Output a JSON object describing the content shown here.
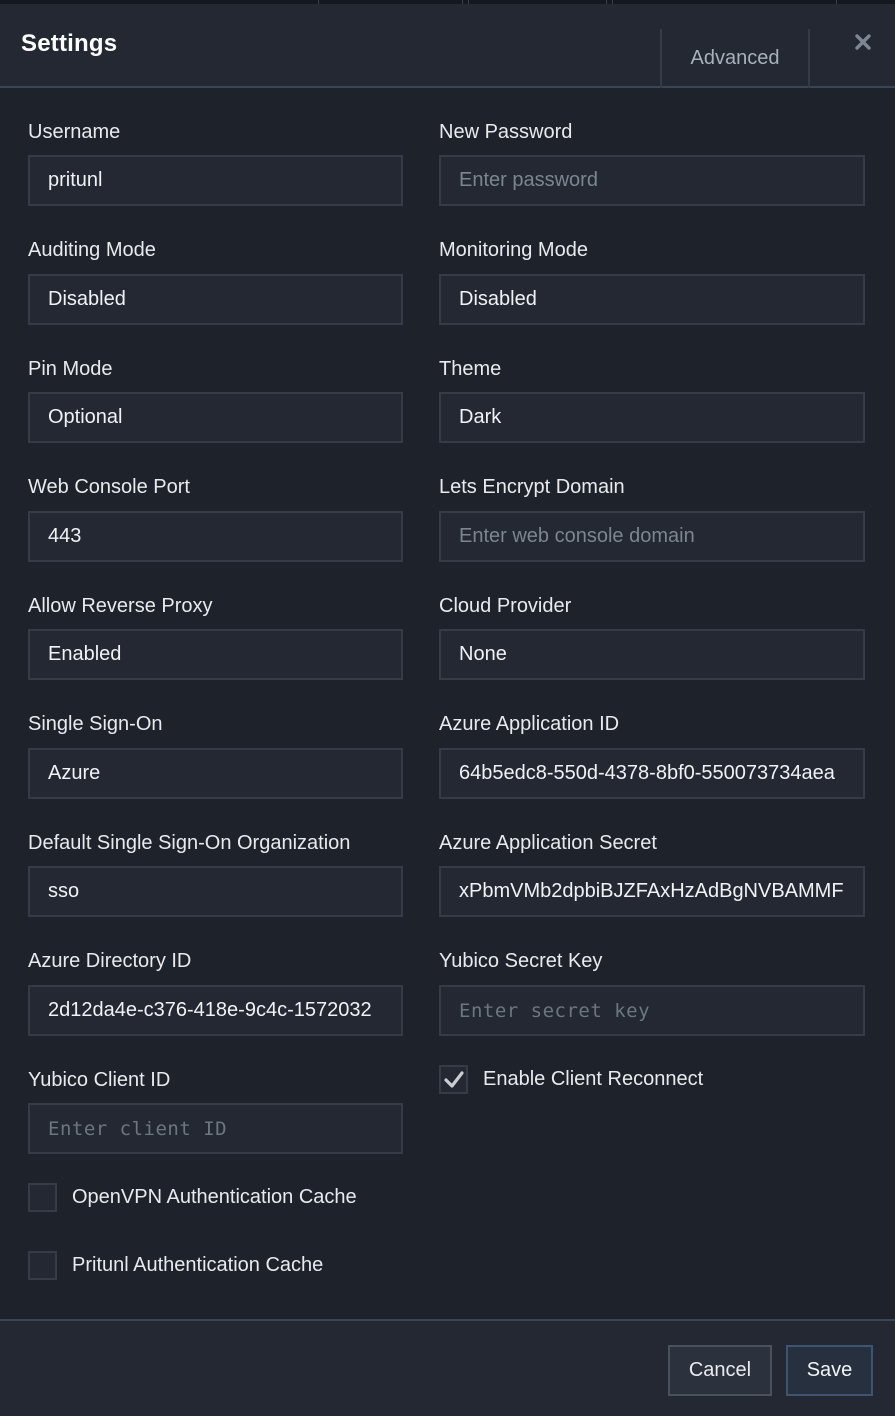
{
  "dialog": {
    "title": "Settings",
    "advanced_tab": "Advanced",
    "close_glyph": "×"
  },
  "fields": {
    "username": {
      "label": "Username",
      "value": "pritunl"
    },
    "new_password": {
      "label": "New Password",
      "placeholder": "Enter password"
    },
    "auditing_mode": {
      "label": "Auditing Mode",
      "value": "Disabled"
    },
    "monitoring_mode": {
      "label": "Monitoring Mode",
      "value": "Disabled"
    },
    "pin_mode": {
      "label": "Pin Mode",
      "value": "Optional"
    },
    "theme": {
      "label": "Theme",
      "value": "Dark"
    },
    "web_console_port": {
      "label": "Web Console Port",
      "value": "443"
    },
    "lets_encrypt_domain": {
      "label": "Lets Encrypt Domain",
      "placeholder": "Enter web console domain"
    },
    "allow_reverse_proxy": {
      "label": "Allow Reverse Proxy",
      "value": "Enabled"
    },
    "cloud_provider": {
      "label": "Cloud Provider",
      "value": "None"
    },
    "single_sign_on": {
      "label": "Single Sign-On",
      "value": "Azure"
    },
    "azure_application_id": {
      "label": "Azure Application ID",
      "value": "64b5edc8-550d-4378-8bf0-550073734aea"
    },
    "default_sso_org": {
      "label": "Default Single Sign-On Organization",
      "value": "sso"
    },
    "azure_application_secret": {
      "label": "Azure Application Secret",
      "value": "xPbmVMb2dpbiBJZFAxHzAdBgNVBAMMF"
    },
    "azure_directory_id": {
      "label": "Azure Directory ID",
      "value": "2d12da4e-c376-418e-9c4c-1572032"
    },
    "yubico_secret_key": {
      "label": "Yubico Secret Key",
      "placeholder": "Enter secret key"
    },
    "yubico_client_id": {
      "label": "Yubico Client ID",
      "placeholder": "Enter client ID"
    }
  },
  "checkboxes": {
    "enable_client_reconnect": {
      "label": "Enable Client Reconnect",
      "checked": true
    },
    "openvpn_auth_cache": {
      "label": "OpenVPN Authentication Cache",
      "checked": false
    },
    "pritunl_auth_cache": {
      "label": "Pritunl Authentication Cache",
      "checked": false
    }
  },
  "footer": {
    "cancel_label": "Cancel",
    "save_label": "Save"
  },
  "colors": {
    "background": "#1e222b",
    "panel": "#232833",
    "border": "#363c47",
    "text": "#e8eaed",
    "muted": "#a7b1bc"
  }
}
